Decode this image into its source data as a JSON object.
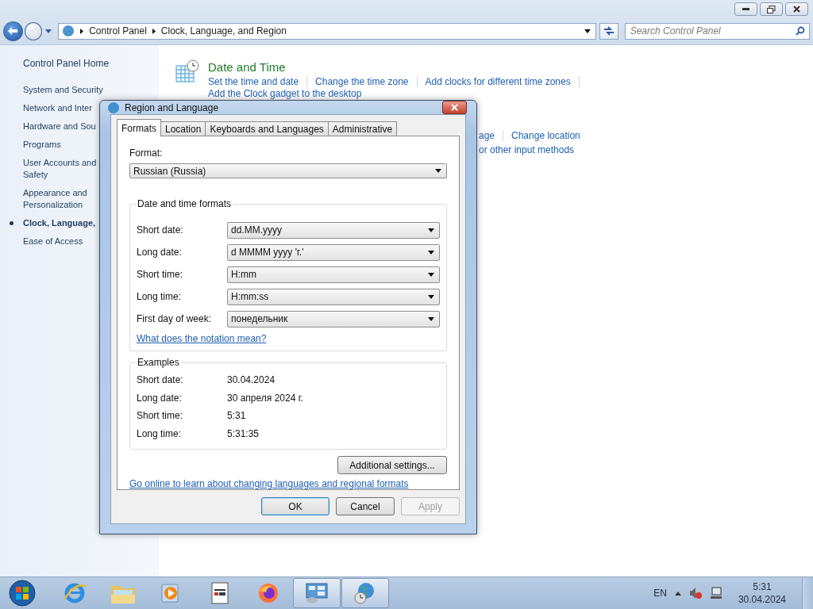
{
  "address_bar": {
    "breadcrumbs": [
      "Control Panel",
      "Clock, Language, and Region"
    ]
  },
  "search": {
    "placeholder": "Search Control Panel"
  },
  "sidebar": {
    "home": "Control Panel Home",
    "items": [
      {
        "label": "System and Security",
        "selected": false
      },
      {
        "label": "Network and Inter",
        "selected": false
      },
      {
        "label": "Hardware and Sou",
        "selected": false
      },
      {
        "label": "Programs",
        "selected": false
      },
      {
        "label": "User Accounts and\nSafety",
        "selected": false
      },
      {
        "label": "Appearance and\nPersonalization",
        "selected": false
      },
      {
        "label": "Clock, Language, ",
        "selected": true
      },
      {
        "label": "Ease of Access",
        "selected": false
      }
    ]
  },
  "date_time": {
    "heading": "Date and Time",
    "links": [
      "Set the time and date",
      "Change the time zone",
      "Add clocks for different time zones"
    ],
    "second_line_link": "Add the Clock gadget to the desktop"
  },
  "region_partial": {
    "links": [
      "age",
      "Change location"
    ],
    "second_line_link": "or other input methods"
  },
  "dialog": {
    "title": "Region and Language",
    "tabs": [
      {
        "label": "Formats",
        "selected": true
      },
      {
        "label": "Location",
        "selected": false
      },
      {
        "label": "Keyboards and Languages",
        "selected": false
      },
      {
        "label": "Administrative",
        "selected": false
      }
    ],
    "format_label": "Format:",
    "format_value": "Russian (Russia)",
    "formats_group": {
      "title": "Date and time formats",
      "rows": [
        {
          "label": "Short date:",
          "value": "dd.MM.yyyy"
        },
        {
          "label": "Long date:",
          "value": "d MMMM yyyy 'г.'"
        },
        {
          "label": "Short time:",
          "value": "H:mm"
        },
        {
          "label": "Long time:",
          "value": "H:mm:ss"
        },
        {
          "label": "First day of week:",
          "value": "понедельник"
        }
      ],
      "link": "What does the notation mean?"
    },
    "examples_group": {
      "title": "Examples",
      "rows": [
        {
          "label": "Short date:",
          "value": "30.04.2024"
        },
        {
          "label": "Long date:",
          "value": "30 апреля 2024 г."
        },
        {
          "label": "Short time:",
          "value": "5:31"
        },
        {
          "label": "Long time:",
          "value": "5:31:35"
        }
      ]
    },
    "additional_button": "Additional settings...",
    "online_link": "Go online to learn about changing languages and regional formats",
    "buttons": [
      {
        "label": "OK",
        "default": true,
        "disabled": false
      },
      {
        "label": "Cancel",
        "default": false,
        "disabled": false
      },
      {
        "label": "Apply",
        "default": false,
        "disabled": true
      }
    ]
  },
  "taskbar": {
    "apps": [
      {
        "kind": "ie",
        "selected": false
      },
      {
        "kind": "folder",
        "selected": false
      },
      {
        "kind": "media",
        "selected": false
      },
      {
        "kind": "notepad",
        "selected": false
      },
      {
        "kind": "firefox",
        "selected": false
      },
      {
        "kind": "control_panel",
        "selected": true
      },
      {
        "kind": "region",
        "selected": true
      }
    ],
    "language": "EN",
    "time": "5:31",
    "date": "30.04.2024"
  }
}
